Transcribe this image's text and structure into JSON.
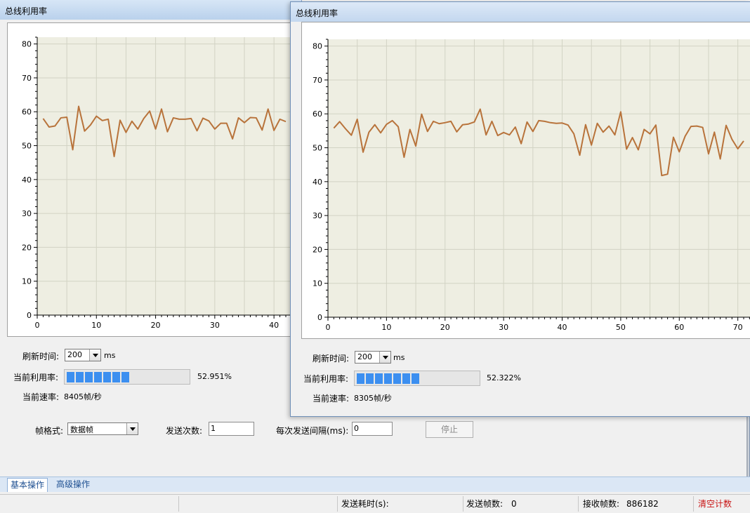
{
  "colors": {
    "line": "#b8733b",
    "plot_bg": "#eeeee2",
    "grid": "#d2d3c4",
    "progress": "#3c8ff0",
    "status_red": "#c81414"
  },
  "windows": [
    {
      "title": "总线利用率",
      "refresh_label": "刷新时间:",
      "refresh_value": "200",
      "refresh_unit": "ms",
      "usage_label": "当前利用率:",
      "usage_value": "52.951%",
      "usage_fraction": 0.52951,
      "rate_label": "当前速率:",
      "rate_value": "8405帧/秒"
    },
    {
      "title": "总线利用率",
      "refresh_label": "刷新时间:",
      "refresh_value": "200",
      "refresh_unit": "ms",
      "usage_label": "当前利用率:",
      "usage_value": "52.322%",
      "usage_fraction": 0.52322,
      "rate_label": "当前速率:",
      "rate_value": "8305帧/秒"
    }
  ],
  "chart_data": [
    {
      "type": "line",
      "title": "",
      "xlabel": "",
      "ylabel": "",
      "xlim": [
        0,
        42
      ],
      "ylim": [
        0,
        82
      ],
      "x_ticks": [
        0,
        10,
        20,
        30,
        40
      ],
      "y_ticks": [
        0,
        10,
        20,
        30,
        40,
        50,
        60,
        70,
        80
      ],
      "grid": true,
      "series": [
        {
          "values": [
            58,
            55.5,
            55.8,
            58.2,
            58.4,
            48.8,
            61.6,
            54.3,
            56.1,
            58.7,
            57.4,
            57.8,
            46.8,
            57.5,
            53.9,
            57.2,
            54.9,
            58,
            60.2,
            54.9,
            60.8,
            54.1,
            58.2,
            57.8,
            57.8,
            58,
            54.4,
            58.1,
            57.3,
            54.9,
            56.6,
            56.6,
            52,
            58.2,
            56.8,
            58.3,
            58.2,
            54.6,
            60.8,
            54.5,
            57.8,
            57.1
          ]
        }
      ]
    },
    {
      "type": "line",
      "title": "",
      "xlabel": "",
      "ylabel": "",
      "xlim": [
        0,
        71
      ],
      "ylim": [
        0,
        82
      ],
      "x_ticks": [
        0,
        10,
        20,
        30,
        40,
        50,
        60,
        70
      ],
      "y_ticks": [
        0,
        10,
        20,
        30,
        40,
        50,
        60,
        70,
        80
      ],
      "grid": true,
      "series": [
        {
          "values": [
            55.8,
            57.7,
            55.6,
            53.7,
            58.4,
            48.7,
            54.6,
            56.8,
            54.4,
            56.9,
            58,
            56.2,
            47.2,
            55.4,
            50.5,
            59.9,
            54.8,
            57.8,
            57.1,
            57.4,
            57.8,
            54.7,
            56.8,
            57,
            57.6,
            61.4,
            53.8,
            57.8,
            53.6,
            54.5,
            53.8,
            56.1,
            51.2,
            57.6,
            54.8,
            58,
            57.8,
            57.4,
            57.2,
            57.3,
            56.7,
            54.1,
            47.8,
            56.8,
            50.8,
            57.2,
            54.6,
            56.4,
            53.8,
            60.6,
            49.6,
            53,
            49.4,
            55.4,
            54.1,
            56.7,
            41.8,
            42.2,
            53.1,
            48.8,
            53.4,
            56.3,
            56.4,
            56,
            48.2,
            54.6,
            46.7,
            56.6,
            52.5,
            49.7,
            52
          ]
        }
      ]
    }
  ],
  "bottom_panel": {
    "frame_format_label": "帧格式:",
    "frame_format_value": "数据帧",
    "send_count_label": "发送次数:",
    "send_count_value": "1",
    "interval_label": "每次发送间隔(ms):",
    "interval_value": "0",
    "stop_label": "停止"
  },
  "tabs": [
    {
      "label": "基本操作"
    },
    {
      "label": "高级操作"
    }
  ],
  "status": {
    "send_time_label": "发送耗时(s):",
    "send_time_value": "",
    "sent_frames_label": "发送帧数:",
    "sent_frames_value": "0",
    "recv_frames_label": "接收帧数:",
    "recv_frames_value": "886182",
    "clear_label": "清空计数"
  }
}
